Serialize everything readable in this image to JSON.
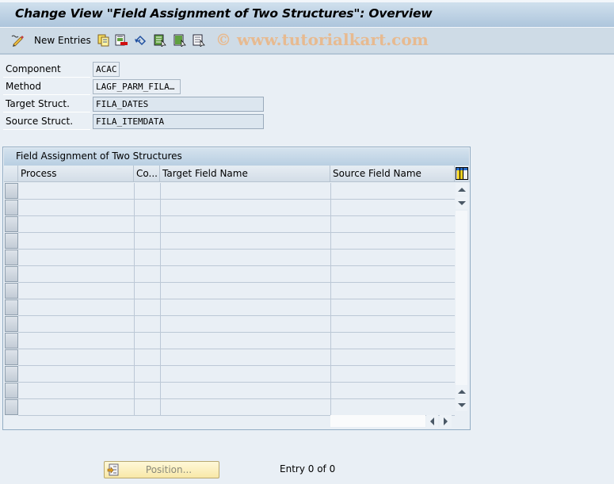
{
  "window": {
    "title": "Change View \"Field Assignment of Two Structures\": Overview"
  },
  "toolbar": {
    "new_entries_label": "New Entries",
    "icons": [
      "edit-pencil-icon",
      "copy-as-icon",
      "delete-icon",
      "undo-change-icon",
      "select-all-icon",
      "select-block-icon",
      "deselect-all-icon"
    ],
    "watermark": "© www.tutorialkart.com"
  },
  "form": {
    "fields": [
      {
        "label": "Component",
        "value": "ACAC"
      },
      {
        "label": "Method",
        "value": "LAGF_PARM_FILA…"
      },
      {
        "label": "Target Struct.",
        "value": "FILA_DATES"
      },
      {
        "label": "Source Struct.",
        "value": "FILA_ITEMDATA"
      }
    ]
  },
  "table": {
    "title": "Field Assignment of Two Structures",
    "columns": [
      "Process",
      "Co...",
      "Target Field Name",
      "Source Field Name"
    ],
    "rows": [
      [
        "",
        "",
        "",
        ""
      ],
      [
        "",
        "",
        "",
        ""
      ],
      [
        "",
        "",
        "",
        ""
      ],
      [
        "",
        "",
        "",
        ""
      ],
      [
        "",
        "",
        "",
        ""
      ],
      [
        "",
        "",
        "",
        ""
      ],
      [
        "",
        "",
        "",
        ""
      ],
      [
        "",
        "",
        "",
        ""
      ],
      [
        "",
        "",
        "",
        ""
      ],
      [
        "",
        "",
        "",
        ""
      ],
      [
        "",
        "",
        "",
        ""
      ],
      [
        "",
        "",
        "",
        ""
      ],
      [
        "",
        "",
        "",
        ""
      ],
      [
        "",
        "",
        "",
        ""
      ]
    ]
  },
  "footer": {
    "position_button_label": "Position...",
    "entry_info": "Entry 0 of 0"
  },
  "colors": {
    "title_bar": "#adc5dc",
    "background": "#e9eff5",
    "watermark": "#e9b98c",
    "position_button": "#f8e8a8"
  }
}
